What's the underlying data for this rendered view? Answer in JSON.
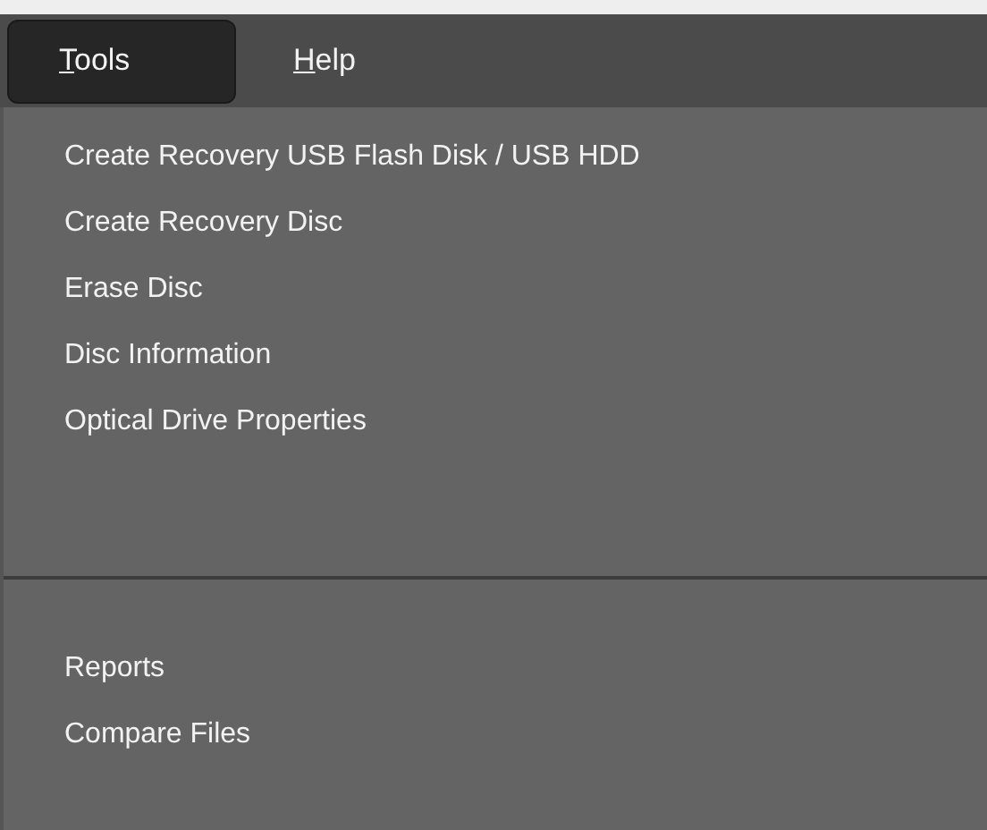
{
  "menu_bar": [
    {
      "label": "Tools",
      "selected": true
    },
    {
      "label": "Help",
      "selected": false
    }
  ],
  "menu": {
    "sections": [
      {
        "items": [
          "Create Recovery USB Flash Disk / USB HDD",
          "Create Recovery Disc",
          "Erase Disc",
          "Disc Information",
          "Optical Drive Properties"
        ]
      },
      {
        "items": [
          "Reports",
          "Compare Files"
        ]
      }
    ]
  }
}
